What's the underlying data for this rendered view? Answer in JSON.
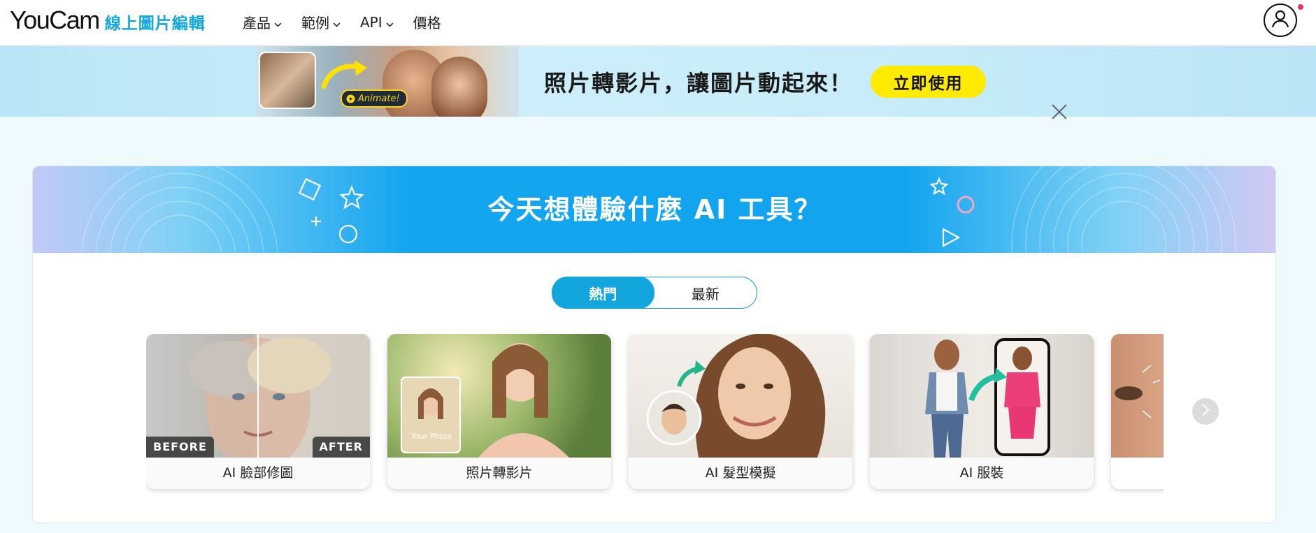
{
  "header": {
    "logo_main": "YouCam",
    "logo_sub": "線上圖片編輯",
    "nav": [
      {
        "label": "產品",
        "has_dropdown": true
      },
      {
        "label": "範例",
        "has_dropdown": true
      },
      {
        "label": "API",
        "has_dropdown": true
      },
      {
        "label": "價格",
        "has_dropdown": false
      }
    ],
    "avatar_icon": "user-icon",
    "notification_color": "#e8316b"
  },
  "promo": {
    "animate_label": "Animate!",
    "title": "照片轉影片，讓圖片動起來！",
    "cta": "立即使用",
    "cta_color": "#ffeb00",
    "close_icon": "close-icon"
  },
  "main": {
    "hero_title": "今天想體驗什麼 AI 工具？",
    "tabs": [
      {
        "label": "熱門",
        "active": true
      },
      {
        "label": "最新",
        "active": false
      }
    ],
    "accent_color": "#13a6dc",
    "tools": [
      {
        "label": "AI 臉部修圖",
        "before_badge": "BEFORE",
        "after_badge": "AFTER"
      },
      {
        "label": "照片轉影片",
        "photo_badge": "Your Photo"
      },
      {
        "label": "AI 髮型模擬"
      },
      {
        "label": "AI 服裝"
      }
    ],
    "next_icon": "chevron-right-icon"
  }
}
